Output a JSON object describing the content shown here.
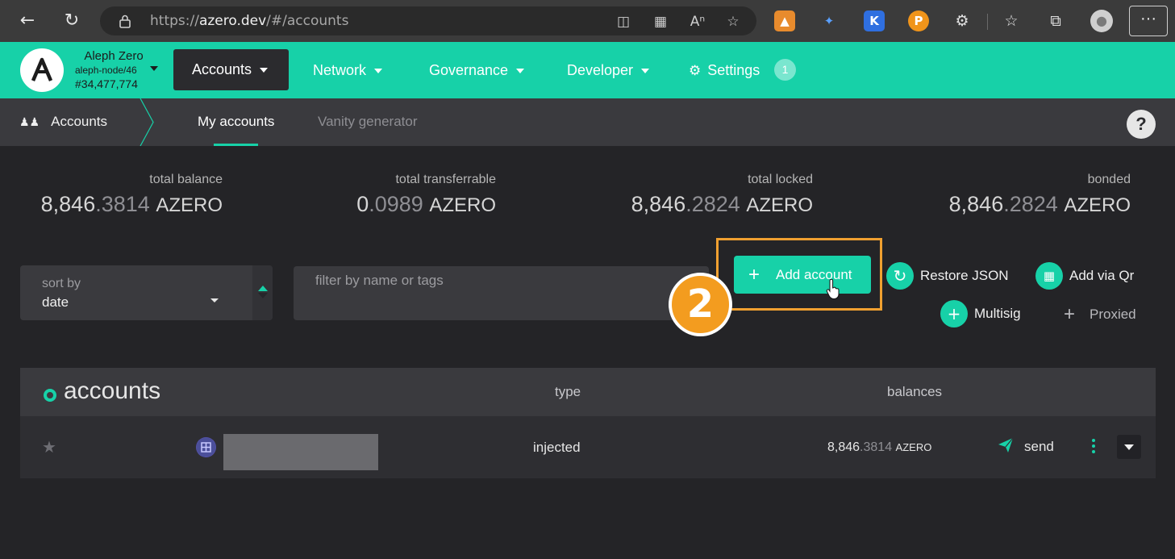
{
  "browser": {
    "url_scheme": "https://",
    "url_host": "azero.dev",
    "url_path": "/#/accounts",
    "icons": [
      "back-icon",
      "refresh-icon",
      "lock-icon",
      "app-available-icon",
      "apps-icon",
      "read-aloud-icon",
      "add-favorite-icon",
      "metamask-icon",
      "satellite-icon",
      "k-extension-icon",
      "p-extension-icon",
      "extensions-icon",
      "favorites-icon",
      "collections-icon",
      "profile-icon",
      "more-icon"
    ]
  },
  "header": {
    "chain_name": "Aleph Zero",
    "node": "aleph-node/46",
    "block": "#34,477,774",
    "menu": [
      {
        "label": "Accounts",
        "active": true
      },
      {
        "label": "Network"
      },
      {
        "label": "Governance"
      },
      {
        "label": "Developer"
      },
      {
        "label": "Settings",
        "badge": "1"
      }
    ],
    "accent_color": "#17d1a8"
  },
  "subnav": {
    "section": "Accounts",
    "tabs": [
      "My accounts",
      "Vanity generator"
    ],
    "help": "?"
  },
  "summary": [
    {
      "label": "total balance",
      "int": "8,846",
      "dec": ".3814",
      "unit": "AZERO"
    },
    {
      "label": "total transferrable",
      "int": "0",
      "dec": ".0989",
      "unit": "AZERO"
    },
    {
      "label": "total locked",
      "int": "8,846",
      "dec": ".2824",
      "unit": "AZERO"
    },
    {
      "label": "bonded",
      "int": "8,846",
      "dec": ".2824",
      "unit": "AZERO"
    }
  ],
  "controls": {
    "sort_label": "sort by",
    "sort_value": "date",
    "filter_placeholder": "filter by name or tags",
    "add_account": "Add account",
    "restore_json": "Restore JSON",
    "add_via_qr": "Add via Qr",
    "multisig": "Multisig",
    "proxied": "Proxied",
    "step_number": "2",
    "highlight_color": "#f0a030"
  },
  "table": {
    "title": "accounts",
    "col_type": "type",
    "col_balances": "balances",
    "rows": [
      {
        "type": "injected",
        "bal_int": "8,846",
        "bal_dec": ".3814",
        "bal_unit": "AZERO",
        "send": "send"
      }
    ]
  }
}
